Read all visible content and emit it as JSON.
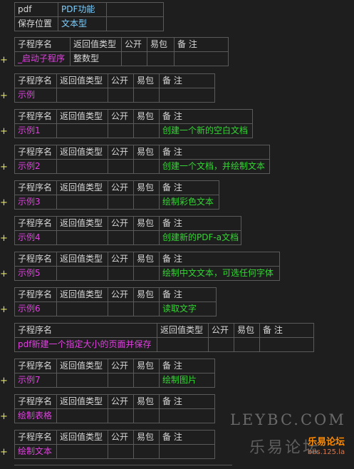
{
  "file_table": {
    "row1": {
      "label": "pdf",
      "value": "PDF功能"
    },
    "row2": {
      "label": "保存位置",
      "value": "文本型"
    }
  },
  "headers": {
    "name": "子程序名",
    "return_type": "返回值类型",
    "public": "公开",
    "easy_pack": "易包",
    "note": "备 注"
  },
  "expand_symbol": "+",
  "subroutines": [
    {
      "name": "_启动子程序",
      "return_type": "整数型",
      "note": ""
    },
    {
      "name": "示例",
      "return_type": "",
      "note": ""
    },
    {
      "name": "示例1",
      "return_type": "",
      "note": "创建一个新的空白文档"
    },
    {
      "name": "示例2",
      "return_type": "",
      "note": "创建一个文档，并绘制文本"
    },
    {
      "name": "示例3",
      "return_type": "",
      "note": "绘制彩色文本"
    },
    {
      "name": "示例4",
      "return_type": "",
      "note": "创建新的PDF-a文档"
    },
    {
      "name": "示例5",
      "return_type": "",
      "note": "绘制中文文本，可选任何字体"
    },
    {
      "name": "示例6",
      "return_type": "",
      "note": "读取文字"
    },
    {
      "name": "pdf新建一个指定大小的页面并保存",
      "return_type": "",
      "note": ""
    },
    {
      "name": "示例7",
      "return_type": "",
      "note": "绘制图片"
    },
    {
      "name": "绘制表格",
      "return_type": "",
      "note": ""
    },
    {
      "name": "绘制文本",
      "return_type": "",
      "note": ""
    }
  ],
  "watermark": {
    "site": "LEYBC.COM",
    "cn": "乐易论坛",
    "badge": "乐易论坛",
    "badge_url": "bbs.125.la"
  },
  "colors": {
    "background": "#1e1e1e",
    "border": "#5a5a5a",
    "name": "#e040e0",
    "note": "#33d633",
    "type_value": "#7fd0ff",
    "plus": "#e0e060"
  }
}
